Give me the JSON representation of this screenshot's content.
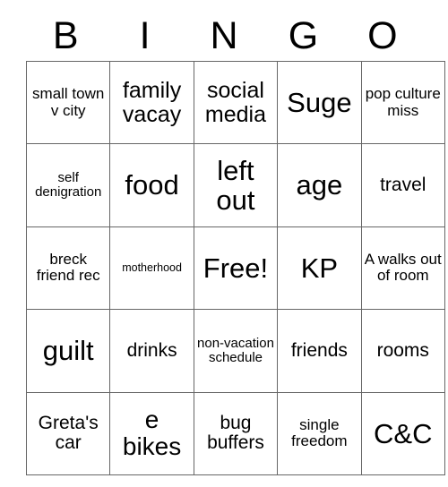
{
  "card": {
    "header_letters": [
      "B",
      "I",
      "N",
      "G",
      "O"
    ],
    "rows": [
      [
        {
          "text": "small town v city",
          "size": "fs-s"
        },
        {
          "text": "family vacay",
          "size": "fs-l"
        },
        {
          "text": "social media",
          "size": "fs-l"
        },
        {
          "text": "Suge",
          "size": "fs-xxl"
        },
        {
          "text": "pop culture miss",
          "size": "fs-s"
        }
      ],
      [
        {
          "text": "self denigration",
          "size": "fs-xs"
        },
        {
          "text": "food",
          "size": "fs-xxl"
        },
        {
          "text": "left out",
          "size": "fs-xxl"
        },
        {
          "text": "age",
          "size": "fs-xxl"
        },
        {
          "text": "travel",
          "size": "fs-m"
        }
      ],
      [
        {
          "text": "breck friend rec",
          "size": "fs-s"
        },
        {
          "text": "motherhood",
          "size": "fs-xxs"
        },
        {
          "text": "Free!",
          "size": "fs-xxl"
        },
        {
          "text": "KP",
          "size": "fs-xxl"
        },
        {
          "text": "A walks out of room",
          "size": "fs-s"
        }
      ],
      [
        {
          "text": "guilt",
          "size": "fs-xxl"
        },
        {
          "text": "drinks",
          "size": "fs-m"
        },
        {
          "text": "non-vacation schedule",
          "size": "fs-xs"
        },
        {
          "text": "friends",
          "size": "fs-m"
        },
        {
          "text": "rooms",
          "size": "fs-m"
        }
      ],
      [
        {
          "text": "Greta's car",
          "size": "fs-m"
        },
        {
          "text": "e bikes",
          "size": "fs-xl"
        },
        {
          "text": "bug buffers",
          "size": "fs-m"
        },
        {
          "text": "single freedom",
          "size": "fs-s"
        },
        {
          "text": "C&C",
          "size": "fs-xxl"
        }
      ]
    ]
  },
  "colors": {
    "border": "#666666",
    "text": "#000000",
    "background": "#ffffff"
  }
}
